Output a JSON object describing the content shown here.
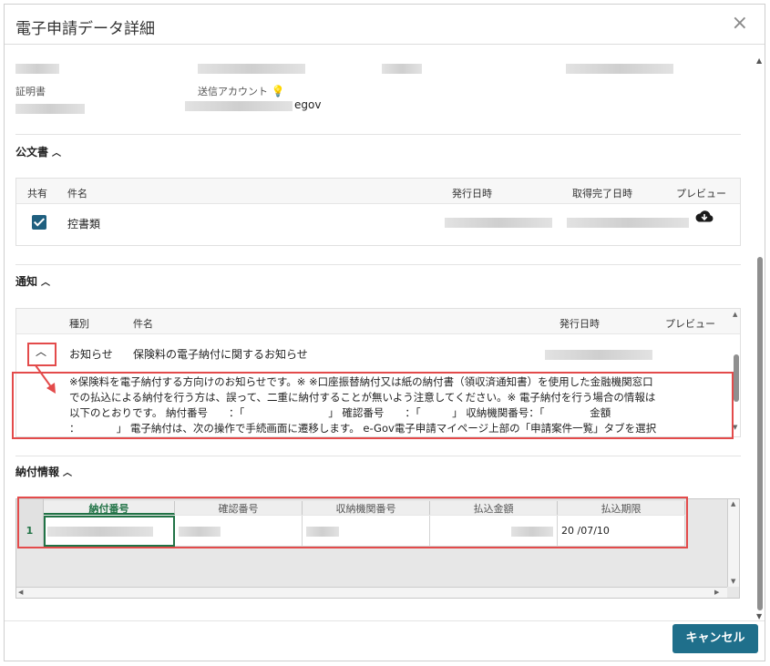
{
  "dialog": {
    "title": "電子申請データ詳細",
    "close_label": "×"
  },
  "info": {
    "cert_label": "証明書",
    "account_label": "送信アカウント",
    "account_suffix": "egov"
  },
  "public_docs": {
    "title": "公文書",
    "headers": [
      "共有",
      "件名",
      "発行日時",
      "取得完了日時",
      "プレビュー"
    ],
    "rows": [
      {
        "shared": true,
        "subject": "控書類"
      }
    ]
  },
  "notice": {
    "title": "通知",
    "headers": [
      "種別",
      "件名",
      "発行日時",
      "プレビュー"
    ],
    "row": {
      "type": "お知らせ",
      "subject": "保険料の電子納付に関するお知らせ"
    },
    "body_lines": [
      "※保険料を電子納付する方向けのお知らせです。※ ※口座振替納付又は紙の納付書（領収済通知書）を使用した金融機関窓口",
      "での払込による納付を行う方は、誤って、二重に納付することが無いよう注意してください。※ 電子納付を行う場合の情報は",
      "以下のとおりです。 納付番号　　：「　　　　　　　　」 確認番号　　：「　　　」 収納機関番号：「　　　　 金額",
      "：　　　　」 電子納付は、次の操作で手続画面に遷移します。 e-Gov電子申請マイページ上部の「申請案件一覧」タブを選択"
    ]
  },
  "payment": {
    "title": "納付情報",
    "columns": [
      "納付番号",
      "確認番号",
      "収納機関番号",
      "払込金額",
      "払込期限"
    ],
    "row_number": "1",
    "due_date": "20  /07/10"
  },
  "footer": {
    "cancel_label": "キャンセル"
  },
  "colors": {
    "accent": "#1f6f8b",
    "highlight": "#e34b4b",
    "excel_green": "#217346"
  }
}
